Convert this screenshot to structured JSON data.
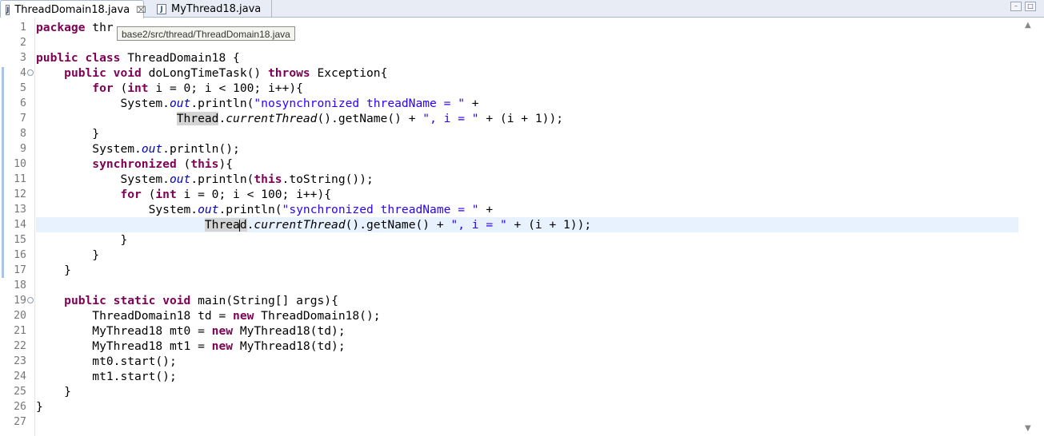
{
  "tabs": [
    {
      "label": "ThreadDomain18.java",
      "icon": "java-file-icon",
      "close": "⌧",
      "active": true
    },
    {
      "label": "MyThread18.java",
      "icon": "java-file-icon",
      "active": false
    }
  ],
  "tab_icon_letter": "J",
  "window_controls": {
    "minimize": "–",
    "maximize": "□"
  },
  "tooltip": "base2/src/thread/ThreadDomain18.java",
  "line_numbers": [
    "1",
    "2",
    "3",
    "4",
    "5",
    "6",
    "7",
    "8",
    "9",
    "10",
    "11",
    "12",
    "13",
    "14",
    "15",
    "16",
    "17",
    "18",
    "19",
    "20",
    "21",
    "22",
    "23",
    "24",
    "25",
    "26",
    "27"
  ],
  "fold_glyph": "⊖",
  "code": {
    "l1": {
      "kw": "package",
      "rest": " thr"
    },
    "l3": {
      "kw1": "public",
      "kw2": "class",
      "rest": " ThreadDomain18 {"
    },
    "l4": {
      "indent": "    ",
      "kw1": "public",
      "kw2": "void",
      "mid": " doLongTimeTask() ",
      "kw3": "throws",
      "rest": " Exception{"
    },
    "l5": {
      "indent": "        ",
      "kw1": "for",
      "mid": " (",
      "kw2": "int",
      "rest": " i = 0; i < 100; i++){"
    },
    "l6": {
      "indent": "            ",
      "a": "System.",
      "fld": "out",
      "b": ".println(",
      "str": "\"nosynchronized threadName = \"",
      "c": " +"
    },
    "l7": {
      "indent": "                    ",
      "occ": "Thread",
      "dot": ".",
      "ital": "currentThread",
      "b": "().getName() + ",
      "str1": "\", i = \"",
      "c": " + (i + 1));"
    },
    "l8": {
      "indent": "        ",
      "rest": "}"
    },
    "l9": {
      "indent": "        ",
      "a": "System.",
      "fld": "out",
      "b": ".println();"
    },
    "l10": {
      "indent": "        ",
      "kw1": "synchronized",
      "mid": " (",
      "kw2": "this",
      "rest": "){"
    },
    "l11": {
      "indent": "            ",
      "a": "System.",
      "fld": "out",
      "b": ".println(",
      "kw": "this",
      "c": ".toString());"
    },
    "l12": {
      "indent": "            ",
      "kw1": "for",
      "mid": " (",
      "kw2": "int",
      "rest": " i = 0; i < 100; i++){"
    },
    "l13": {
      "indent": "                ",
      "a": "System.",
      "fld": "out",
      "b": ".println(",
      "str": "\"synchronized threadName = \"",
      "c": " +"
    },
    "l14": {
      "indent": "                        ",
      "occ1": "Threa",
      "occ2": "d",
      "dot": ".",
      "ital": "currentThread",
      "b": "().getName() + ",
      "str1": "\", i = \"",
      "c": " + (i + 1));"
    },
    "l15": {
      "indent": "            ",
      "rest": "}"
    },
    "l16": {
      "indent": "        ",
      "rest": "}"
    },
    "l17": {
      "indent": "    ",
      "rest": "}"
    },
    "l19": {
      "indent": "    ",
      "kw1": "public",
      "kw2": "static",
      "kw3": "void",
      "rest": " main(String[] args){"
    },
    "l20": {
      "indent": "        ",
      "a": "ThreadDomain18 td = ",
      "kw": "new",
      "b": " ThreadDomain18();"
    },
    "l21": {
      "indent": "        ",
      "a": "MyThread18 mt0 = ",
      "kw": "new",
      "b": " MyThread18(td);"
    },
    "l22": {
      "indent": "        ",
      "a": "MyThread18 mt1 = ",
      "kw": "new",
      "b": " MyThread18(td);"
    },
    "l23": {
      "indent": "        ",
      "rest": "mt0.start();"
    },
    "l24": {
      "indent": "        ",
      "rest": "mt1.start();"
    },
    "l25": {
      "indent": "    ",
      "rest": "}"
    },
    "l26": {
      "rest": "}"
    }
  },
  "scroll": {
    "up": "▲",
    "down": "▼"
  }
}
